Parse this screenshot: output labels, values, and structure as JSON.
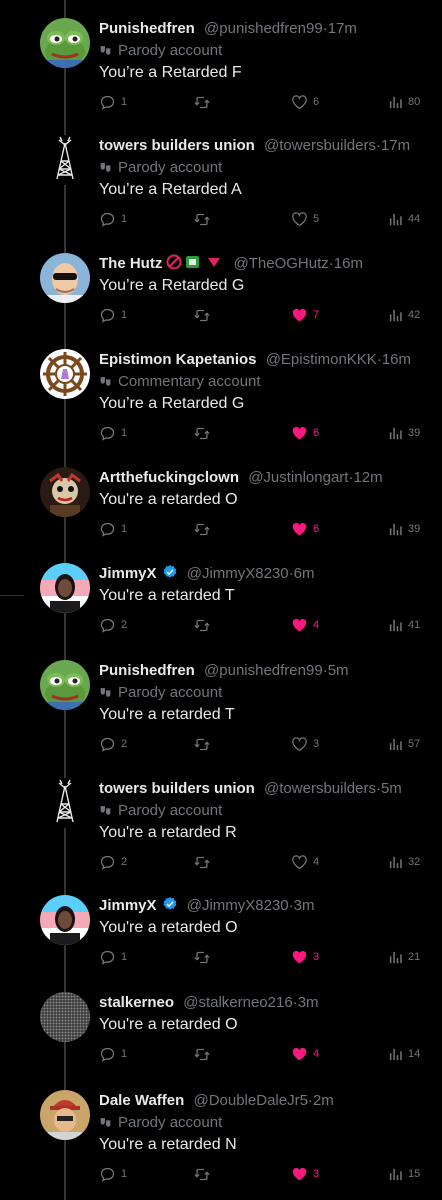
{
  "tweets": [
    {
      "name": "Punishedfren",
      "handle": "@punishedfren99",
      "time": "17m",
      "label": "Parody account",
      "text": "You’re a Retarded F",
      "replies": "1",
      "likes": "6",
      "views": "80",
      "liked": false,
      "avatar": "pepe"
    },
    {
      "name": "towers builders union",
      "handle": "@towersbuilders",
      "time": "17m",
      "label": "Parody account",
      "text": "You’re a Retarded A",
      "replies": "1",
      "likes": "5",
      "views": "44",
      "liked": false,
      "avatar": "tower"
    },
    {
      "name": "The Hutz",
      "handle": "@TheOGHutz",
      "time": "16m",
      "label": "",
      "text": "You’re a Retarded G",
      "replies": "1",
      "likes": "7",
      "views": "42",
      "liked": true,
      "avatar": "hutz",
      "emojis": true
    },
    {
      "name": "Epistimon Kapetanios",
      "handle": "@EpistimonKKK",
      "time": "16m",
      "label": "Commentary account",
      "text": "You’re a Retarded G",
      "replies": "1",
      "likes": "6",
      "views": "39",
      "liked": true,
      "avatar": "wheel"
    },
    {
      "name": "Artthefuckingclown",
      "handle": "@Justinlongart",
      "time": "12m",
      "label": "",
      "text": "You're a retarded O",
      "replies": "1",
      "likes": "6",
      "views": "39",
      "liked": true,
      "avatar": "clown"
    },
    {
      "name": "JimmyX",
      "handle": "@JimmyX8230",
      "time": "6m",
      "label": "",
      "text": "You're a retarded T",
      "replies": "2",
      "likes": "4",
      "views": "41",
      "liked": true,
      "avatar": "jimmy",
      "verified": true
    },
    {
      "name": "Punishedfren",
      "handle": "@punishedfren99",
      "time": "5m",
      "label": "Parody account",
      "text": "You're a retarded T",
      "replies": "2",
      "likes": "3",
      "views": "57",
      "liked": false,
      "avatar": "pepe"
    },
    {
      "name": "towers builders union",
      "handle": "@towersbuilders",
      "time": "5m",
      "label": "Parody account",
      "text": "You're a retarded R",
      "replies": "2",
      "likes": "4",
      "views": "32",
      "liked": false,
      "avatar": "tower"
    },
    {
      "name": "JimmyX",
      "handle": "@JimmyX8230",
      "time": "3m",
      "label": "",
      "text": "You're a retarded O",
      "replies": "1",
      "likes": "3",
      "views": "21",
      "liked": true,
      "avatar": "jimmy",
      "verified": true
    },
    {
      "name": "stalkerneo",
      "handle": "@stalkerneo216",
      "time": "3m",
      "label": "",
      "text": "You're a retarded O",
      "replies": "1",
      "likes": "4",
      "views": "14",
      "liked": true,
      "avatar": "noise"
    },
    {
      "name": "Dale Waffen",
      "handle": "@DoubleDaleJr5",
      "time": "2m",
      "label": "Parody account",
      "text": "You're a retarded N",
      "replies": "1",
      "likes": "3",
      "views": "15",
      "liked": true,
      "avatar": "dale"
    }
  ],
  "colors": {
    "background": "#000000",
    "text": "#e7e9ea",
    "muted": "#71767b",
    "like": "#f91880",
    "verified": "#1d9bf0"
  }
}
